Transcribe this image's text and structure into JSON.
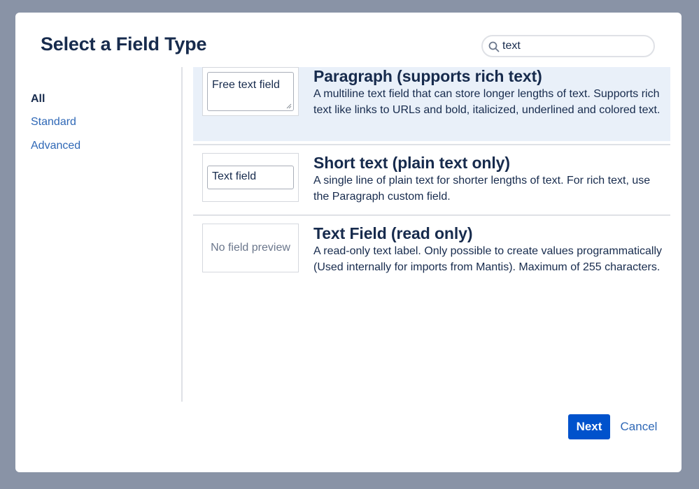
{
  "dialog": {
    "title": "Select a Field Type"
  },
  "search": {
    "value": "text",
    "icon": "search-icon"
  },
  "sidebar": {
    "items": [
      {
        "label": "All",
        "active": true
      },
      {
        "label": "Standard",
        "active": false
      },
      {
        "label": "Advanced",
        "active": false
      }
    ]
  },
  "field_types": [
    {
      "title": "Paragraph (supports rich text)",
      "description": "A multiline text field that can store longer lengths of text. Supports rich text like links to URLs and bold, italicized, underlined and colored text.",
      "preview_text": "Free text field",
      "selected": true
    },
    {
      "title": "Short text (plain text only)",
      "description": "A single line of plain text for shorter lengths of text. For rich text, use the Paragraph custom field.",
      "preview_text": "Text field",
      "selected": false
    },
    {
      "title": "Text Field (read only)",
      "description": "A read-only text label. Only possible to create values programmatically (Used internally for imports from Mantis). Maximum of 255 characters.",
      "preview_text": "No field preview",
      "selected": false
    }
  ],
  "footer": {
    "next_label": "Next",
    "cancel_label": "Cancel"
  },
  "colors": {
    "overlay": "#8993a6",
    "primary": "#0052cc",
    "link": "#2f68b6",
    "heading": "#172b4d",
    "selected_row": "#e9f0f9"
  }
}
